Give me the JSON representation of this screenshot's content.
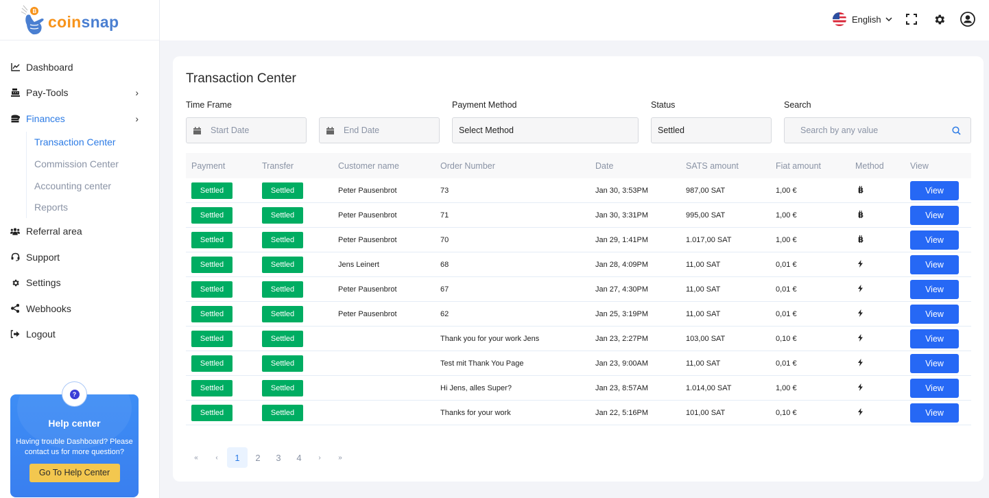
{
  "brand": {
    "part1": "coin",
    "part2": "snap"
  },
  "header": {
    "language": "English",
    "icons": [
      "fullscreen-icon",
      "settings-icon",
      "user-account-icon"
    ]
  },
  "sidebar": {
    "items": [
      {
        "label": "Dashboard",
        "icon": "chart-line-icon"
      },
      {
        "label": "Pay-Tools",
        "icon": "cash-register-icon",
        "has_children": true
      },
      {
        "label": "Finances",
        "icon": "coins-icon",
        "has_children": true,
        "active": true,
        "children": [
          {
            "label": "Transaction Center",
            "active": true
          },
          {
            "label": "Commission Center"
          },
          {
            "label": "Accounting center"
          },
          {
            "label": "Reports"
          }
        ]
      },
      {
        "label": "Referral area",
        "icon": "users-icon"
      },
      {
        "label": "Support",
        "icon": "headset-icon"
      },
      {
        "label": "Settings",
        "icon": "gear-icon"
      },
      {
        "label": "Webhooks",
        "icon": "share-icon"
      },
      {
        "label": "Logout",
        "icon": "logout-icon"
      }
    ],
    "help": {
      "title": "Help center",
      "text": "Having trouble Dashboard? Please contact us for more question?",
      "button": "Go To Help Center"
    }
  },
  "main": {
    "title": "Transaction Center",
    "filters": {
      "time_frame_label": "Time Frame",
      "start_placeholder": "Start Date",
      "end_placeholder": "End Date",
      "payment_method_label": "Payment Method",
      "payment_method_value": "Select Method",
      "status_label": "Status",
      "status_value": "Settled",
      "search_label": "Search",
      "search_placeholder": "Search by any value"
    },
    "columns": [
      "Payment",
      "Transfer",
      "Customer name",
      "Order Number",
      "Date",
      "SATS amount",
      "Fiat amount",
      "Method",
      "View"
    ],
    "rows": [
      {
        "payment": "Settled",
        "transfer": "Settled",
        "customer": "Peter Pausenbrot",
        "order": "73",
        "date": "Jan 30, 3:53PM",
        "sats": "987,00 SAT",
        "fiat": "1,00 €",
        "method": "bitcoin",
        "view": "View"
      },
      {
        "payment": "Settled",
        "transfer": "Settled",
        "customer": "Peter Pausenbrot",
        "order": "71",
        "date": "Jan 30, 3:31PM",
        "sats": "995,00 SAT",
        "fiat": "1,00 €",
        "method": "bitcoin",
        "view": "View"
      },
      {
        "payment": "Settled",
        "transfer": "Settled",
        "customer": "Peter Pausenbrot",
        "order": "70",
        "date": "Jan 29, 1:41PM",
        "sats": "1.017,00 SAT",
        "fiat": "1,00 €",
        "method": "bitcoin",
        "view": "View"
      },
      {
        "payment": "Settled",
        "transfer": "Settled",
        "customer": "Jens Leinert",
        "order": "68",
        "date": "Jan 28, 4:09PM",
        "sats": "11,00 SAT",
        "fiat": "0,01 €",
        "method": "lightning",
        "view": "View"
      },
      {
        "payment": "Settled",
        "transfer": "Settled",
        "customer": "Peter Pausenbrot",
        "order": "67",
        "date": "Jan 27, 4:30PM",
        "sats": "11,00 SAT",
        "fiat": "0,01 €",
        "method": "lightning",
        "view": "View"
      },
      {
        "payment": "Settled",
        "transfer": "Settled",
        "customer": "Peter Pausenbrot",
        "order": "62",
        "date": "Jan 25, 3:19PM",
        "sats": "11,00 SAT",
        "fiat": "0,01 €",
        "method": "lightning",
        "view": "View"
      },
      {
        "payment": "Settled",
        "transfer": "Settled",
        "customer": "",
        "order": "Thank you for your work Jens",
        "date": "Jan 23, 2:27PM",
        "sats": "103,00 SAT",
        "fiat": "0,10 €",
        "method": "lightning",
        "view": "View"
      },
      {
        "payment": "Settled",
        "transfer": "Settled",
        "customer": "",
        "order": "Test mit Thank You Page",
        "date": "Jan 23, 9:00AM",
        "sats": "11,00 SAT",
        "fiat": "0,01 €",
        "method": "lightning",
        "view": "View"
      },
      {
        "payment": "Settled",
        "transfer": "Settled",
        "customer": "",
        "order": "Hi Jens, alles Super?",
        "date": "Jan 23, 8:57AM",
        "sats": "1.014,00 SAT",
        "fiat": "1,00 €",
        "method": "lightning",
        "view": "View"
      },
      {
        "payment": "Settled",
        "transfer": "Settled",
        "customer": "",
        "order": "Thanks for your work",
        "date": "Jan 22, 5:16PM",
        "sats": "101,00 SAT",
        "fiat": "0,10 €",
        "method": "lightning",
        "view": "View"
      }
    ],
    "pagination": {
      "first": "«",
      "prev": "‹",
      "next": "›",
      "last": "»",
      "pages": [
        "1",
        "2",
        "3",
        "4"
      ],
      "current": "1"
    }
  },
  "colors": {
    "accent": "#2c7be5",
    "settled_badge": "#00ad62",
    "view_button": "#2668f5",
    "help_card": "#3d8df5",
    "help_button": "#f3c74f"
  }
}
